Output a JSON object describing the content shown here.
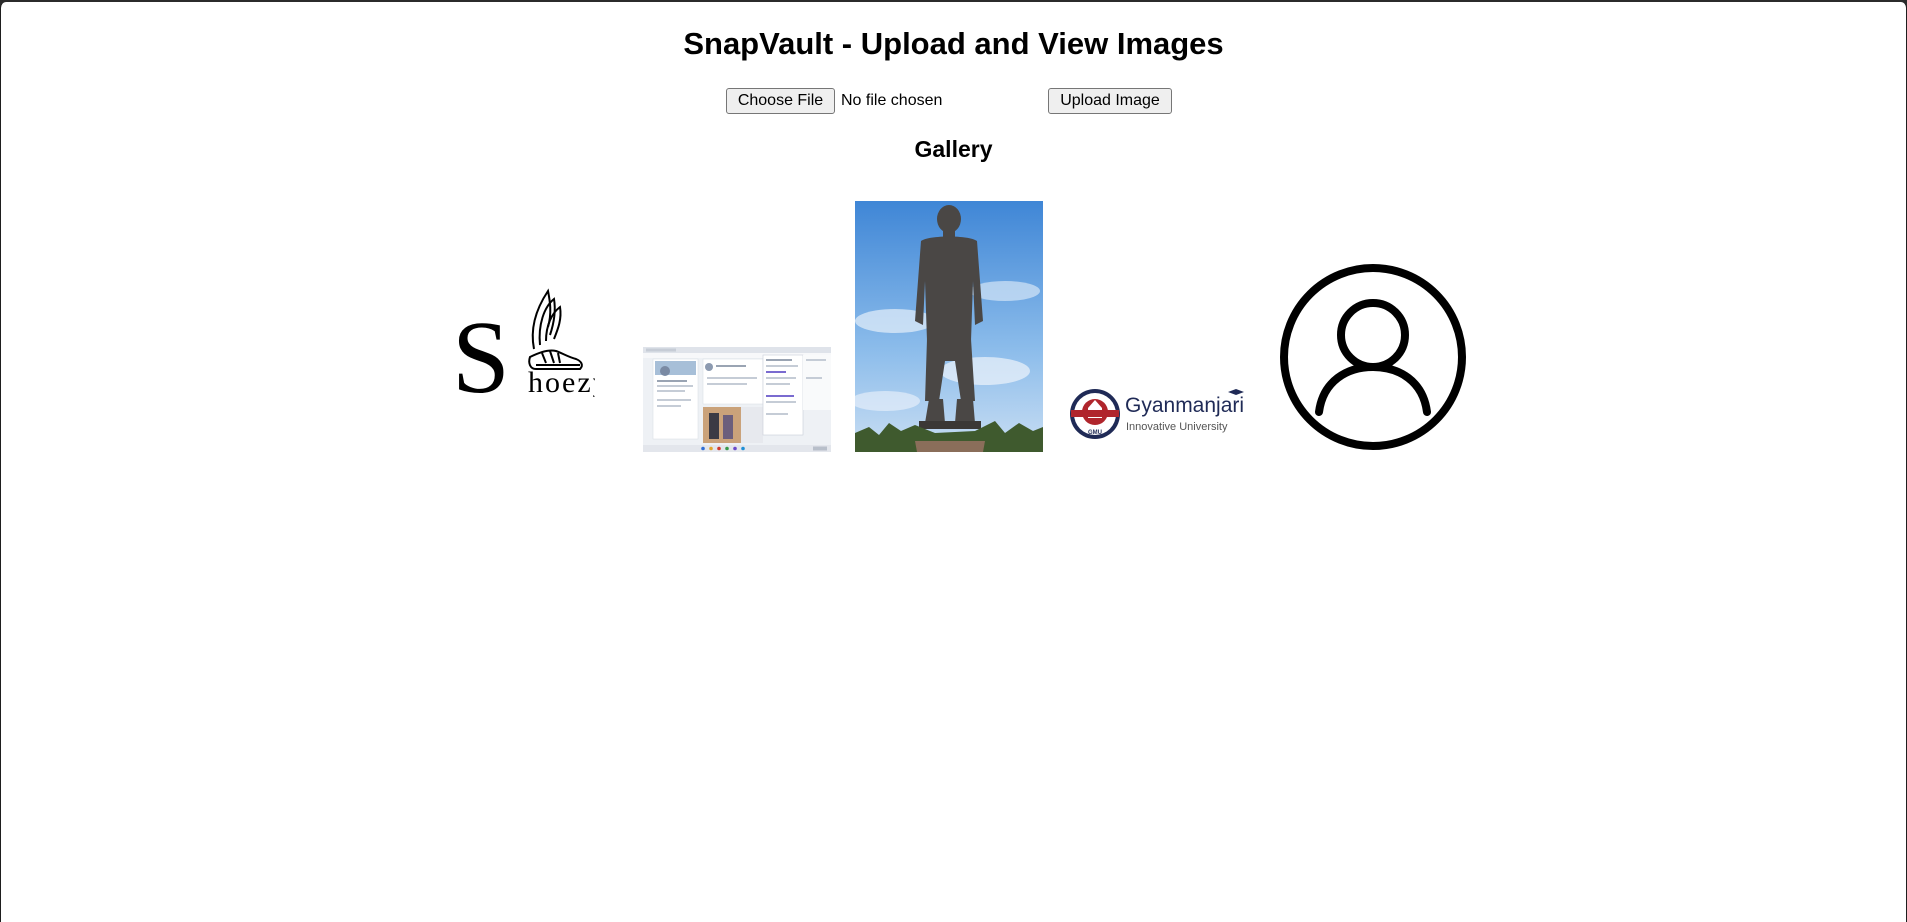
{
  "page": {
    "title": "SnapVault - Upload and View Images"
  },
  "upload_form": {
    "choose_file_label": "Choose File",
    "file_status": "No file chosen",
    "upload_button_label": "Upload Image"
  },
  "gallery": {
    "heading": "Gallery",
    "images": [
      {
        "kind": "logo",
        "logo_text": "hoezy",
        "logo_initial": "S"
      },
      {
        "kind": "screenshot"
      },
      {
        "kind": "photo"
      },
      {
        "kind": "logo",
        "logo_name": "Gyanmanjari",
        "logo_subtitle": "Innovative University",
        "seal_text": "GMU"
      },
      {
        "kind": "icon",
        "icon": "user-avatar-icon"
      }
    ]
  },
  "colors": {
    "sky": "#6aa6e0",
    "gyan_navy": "#1f2a56",
    "gyan_red": "#b0252c"
  }
}
